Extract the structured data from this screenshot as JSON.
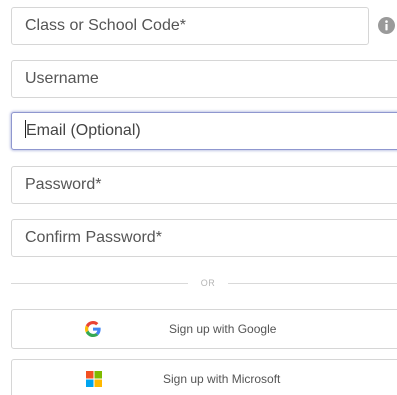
{
  "form": {
    "class_code_placeholder": "Class or School Code*",
    "username_placeholder": "Username",
    "email_placeholder": "Email (Optional)",
    "password_placeholder": "Password*",
    "confirm_password_placeholder": "Confirm Password*",
    "info_icon": "info-circle-icon"
  },
  "divider": {
    "label": "OR"
  },
  "sso": {
    "google_label": "Sign up with Google",
    "google_icon": "google-g-icon",
    "microsoft_label": "Sign up with Microsoft",
    "microsoft_icon": "microsoft-logo-icon"
  },
  "colors": {
    "focus_border": "#8f97cf",
    "google_red": "#ea4335",
    "google_blue": "#4285f4",
    "google_green": "#34a853",
    "google_yellow": "#fbbc05",
    "ms_red": "#f25022",
    "ms_green": "#7fba00",
    "ms_blue": "#00a4ef",
    "ms_yellow": "#ffb900"
  }
}
